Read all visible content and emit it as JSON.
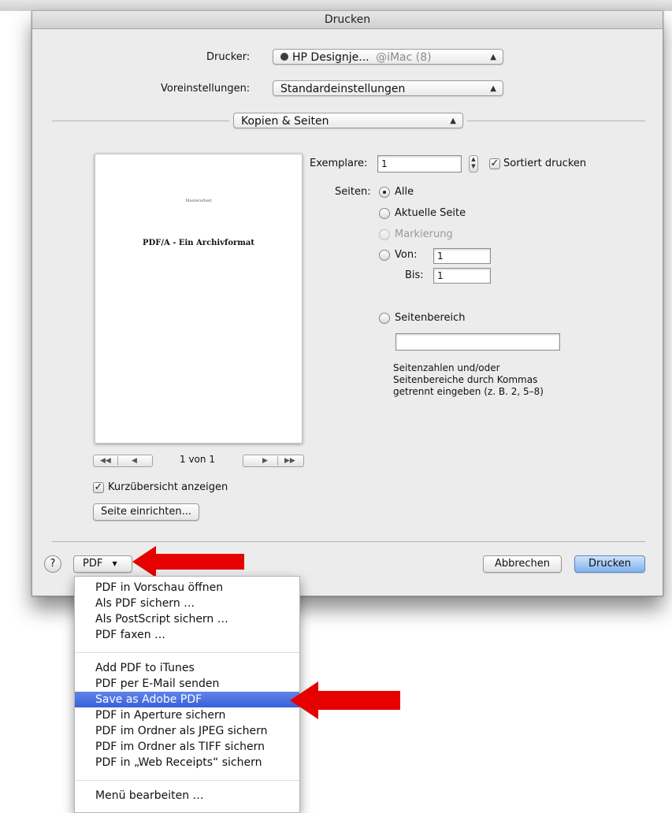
{
  "window": {
    "title": "Drucken"
  },
  "printer": {
    "label": "Drucker:",
    "value": "HP Designje...",
    "suffix": "@iMac (8)"
  },
  "presets": {
    "label": "Voreinstellungen:",
    "value": "Standardeinstellungen"
  },
  "section": {
    "value": "Kopien & Seiten"
  },
  "copies": {
    "label": "Exemplare:",
    "value": "1",
    "collate_label": "Sortiert drucken",
    "collate_checked": true
  },
  "pages": {
    "label": "Seiten:",
    "options": [
      "Alle",
      "Aktuelle Seite",
      "Markierung",
      "Von:",
      "Seitenbereich"
    ],
    "selected": "Alle",
    "from_label": "Von:",
    "from_value": "1",
    "to_label": "Bis:",
    "to_value": "1",
    "range_value": "",
    "hint": [
      "Seitenzahlen und/oder",
      "Seitenbereiche durch Kommas",
      "getrennt eingeben (z. B. 2, 5–8)"
    ]
  },
  "preview": {
    "header": "Masterarbeit",
    "title": "PDF/A - Ein Archivformat",
    "page_indicator": "1 von 1",
    "nav_first": "◀◀",
    "nav_prev": "◀",
    "nav_next": "▶",
    "nav_last": "▶▶"
  },
  "show_preview": {
    "label": "Kurzübersicht anzeigen",
    "checked": true
  },
  "page_setup": {
    "label": "Seite einrichten..."
  },
  "footer": {
    "help": "?",
    "pdf": "PDF",
    "pdf_arrow": "▼",
    "cancel": "Abbrechen",
    "print": "Drucken"
  },
  "pdf_menu": {
    "group1": [
      "PDF in Vorschau öffnen",
      "Als PDF sichern …",
      "Als PostScript sichern …",
      "PDF faxen …"
    ],
    "group2": [
      "Add PDF to iTunes",
      "PDF per E-Mail senden",
      "Save as Adobe PDF",
      "PDF in Aperture sichern",
      "PDF im Ordner als JPEG sichern",
      "PDF im Ordner als TIFF sichern",
      "PDF in „Web Receipts“ sichern"
    ],
    "highlighted": "Save as Adobe PDF",
    "group3": [
      "Menü bearbeiten …"
    ]
  },
  "colors": {
    "highlight": "#3b5fd8",
    "annotation_arrow": "#e60000",
    "window_bg": "#ececec"
  }
}
